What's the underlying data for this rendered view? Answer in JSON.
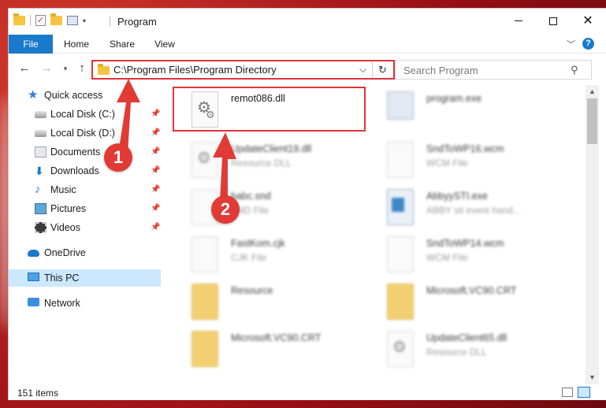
{
  "window": {
    "title": "Program"
  },
  "ribbon": {
    "tabs": [
      "File",
      "Home",
      "Share",
      "View"
    ],
    "help": "?"
  },
  "nav": {
    "address": "C:\\Program Files\\Program Directory",
    "search_placeholder": "Search Program"
  },
  "sidebar": {
    "items": [
      {
        "label": "Quick access",
        "icon": "star-icon"
      },
      {
        "label": "Local Disk (C:)",
        "icon": "disk-icon",
        "pinned": true
      },
      {
        "label": "Local Disk (D:)",
        "icon": "disk-icon",
        "pinned": true
      },
      {
        "label": "Documents",
        "icon": "documents-icon",
        "pinned": true
      },
      {
        "label": "Downloads",
        "icon": "download-icon",
        "pinned": true
      },
      {
        "label": "Music",
        "icon": "music-icon",
        "pinned": true
      },
      {
        "label": "Pictures",
        "icon": "pictures-icon",
        "pinned": true
      },
      {
        "label": "Videos",
        "icon": "videos-icon",
        "pinned": true
      },
      {
        "label": "OneDrive",
        "icon": "cloud-icon"
      },
      {
        "label": "This PC",
        "icon": "computer-icon",
        "selected": true
      },
      {
        "label": "Network",
        "icon": "network-icon"
      }
    ]
  },
  "files": [
    {
      "name": "remot086.dll",
      "type": "",
      "icon": "dll-gear-icon",
      "highlighted": true
    },
    {
      "name": "program.exe",
      "type": "",
      "icon": "exe-icon"
    },
    {
      "name": "UpdateClient19.dll",
      "type": "Resource DLL",
      "icon": "dll-gear-icon"
    },
    {
      "name": "SndToWP16.wcm",
      "type": "WCM File",
      "icon": "file-icon"
    },
    {
      "name": "babc.snd",
      "type": "SND File",
      "icon": "file-icon"
    },
    {
      "name": "AbbyySTI.exe",
      "type": "ABBY sti event hand...",
      "icon": "app-window-icon"
    },
    {
      "name": "FastKom.cjk",
      "type": "CJK File",
      "icon": "file-icon"
    },
    {
      "name": "SndToWP14.wcm",
      "type": "WCM File",
      "icon": "file-icon"
    },
    {
      "name": "Resource",
      "type": "",
      "icon": "folder-icon"
    },
    {
      "name": "Microsoft.VC90.CRT",
      "type": "",
      "icon": "folder-icon"
    },
    {
      "name": "Microsoft.VC90.CRT",
      "type": "",
      "icon": "folder-icon"
    },
    {
      "name": "UpdateClient65.dll",
      "type": "Resource DLL",
      "icon": "dll-gear-icon"
    }
  ],
  "status": {
    "count": "151 items"
  },
  "annotations": {
    "step1": "1",
    "step2": "2"
  },
  "colors": {
    "accent": "#1979ca",
    "highlight": "#e0333a",
    "selection": "#cce8ff"
  }
}
